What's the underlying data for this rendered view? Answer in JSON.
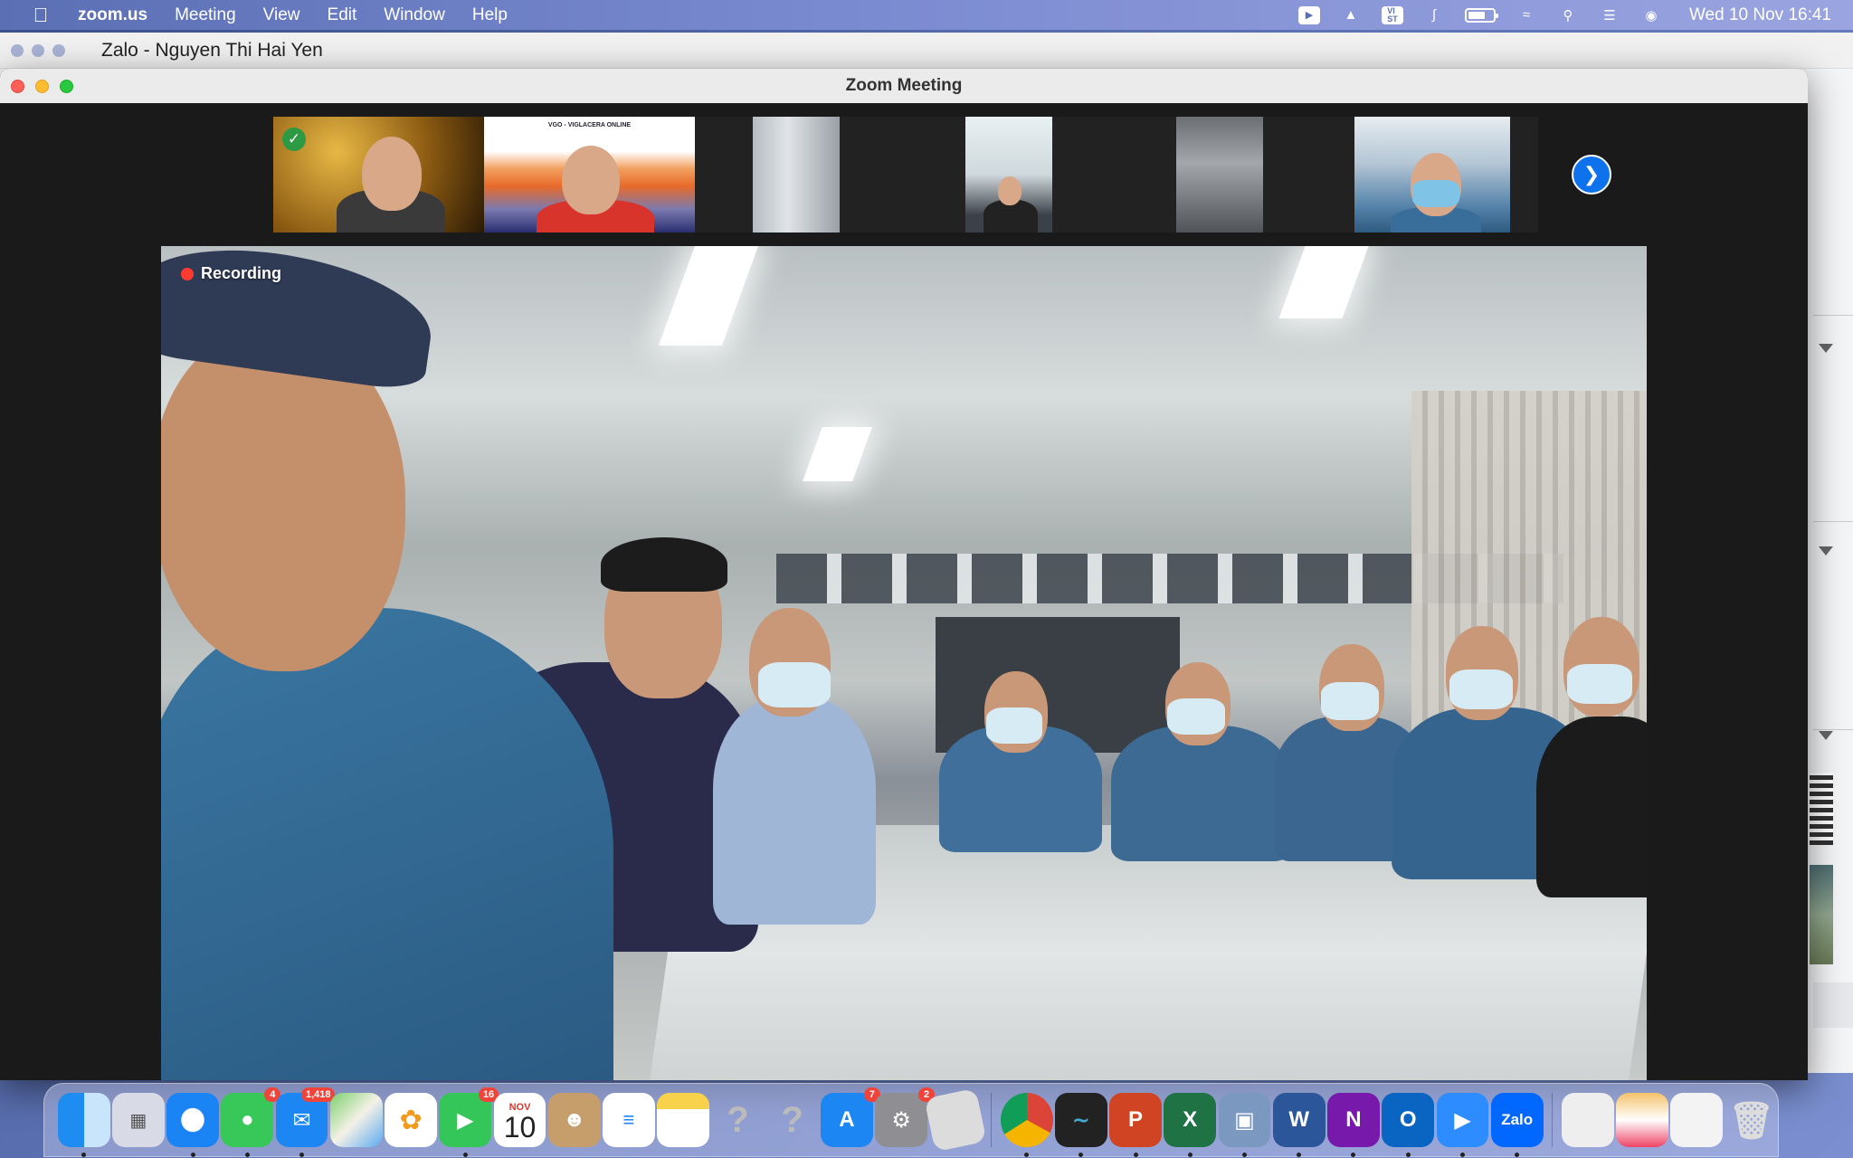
{
  "menubar": {
    "app_name": "zoom.us",
    "menus": [
      "Meeting",
      "View",
      "Edit",
      "Window",
      "Help"
    ],
    "status_icons": [
      "zoom-icon",
      "drive-icon",
      "vi-st-keyboard-icon",
      "bluetooth-icon",
      "battery-icon",
      "wifi-icon",
      "spotlight-search-icon",
      "control-center-icon",
      "siri-icon"
    ],
    "vi_label": "VI\nST",
    "clock": "Wed 10 Nov  16:41",
    "battery_level": 0.7
  },
  "zalo_window": {
    "title": "Zalo - Nguyen Thi Hai Yen"
  },
  "zoom_window": {
    "title": "Zoom Meeting",
    "recording_label": "Recording",
    "gallery_tile_sign": "VGO - VIGLACERA ONLINE",
    "next_page_icon": "chevron-right-icon",
    "accent": "#0e72ed"
  },
  "dock": {
    "apps": [
      {
        "name": "Finder",
        "badge": ""
      },
      {
        "name": "Launchpad",
        "badge": ""
      },
      {
        "name": "Safari",
        "badge": ""
      },
      {
        "name": "Messages",
        "badge": "4"
      },
      {
        "name": "Mail",
        "badge": "1,418"
      },
      {
        "name": "Maps",
        "badge": ""
      },
      {
        "name": "Photos",
        "badge": ""
      },
      {
        "name": "FaceTime",
        "badge": "16"
      },
      {
        "name": "Calendar",
        "badge": "",
        "month": "NOV",
        "day": "10"
      },
      {
        "name": "Contacts",
        "badge": ""
      },
      {
        "name": "Reminders",
        "badge": ""
      },
      {
        "name": "Notes",
        "badge": ""
      },
      {
        "name": "Unknown1",
        "badge": ""
      },
      {
        "name": "Unknown2",
        "badge": ""
      },
      {
        "name": "App Store",
        "badge": "7"
      },
      {
        "name": "System Preferences",
        "badge": "2"
      },
      {
        "name": "Roblox",
        "badge": ""
      },
      {
        "name": "Chrome",
        "badge": ""
      },
      {
        "name": "Stocks",
        "badge": ""
      },
      {
        "name": "PowerPoint",
        "badge": ""
      },
      {
        "name": "Excel",
        "badge": ""
      },
      {
        "name": "Preview",
        "badge": ""
      },
      {
        "name": "Word",
        "badge": ""
      },
      {
        "name": "OneNote",
        "badge": ""
      },
      {
        "name": "Outlook",
        "badge": ""
      },
      {
        "name": "Zoom",
        "badge": ""
      },
      {
        "name": "Zalo",
        "badge": "",
        "label": "Zalo"
      },
      {
        "name": "Documents",
        "badge": ""
      },
      {
        "name": "Downloads",
        "badge": ""
      },
      {
        "name": "Screenshots",
        "badge": ""
      },
      {
        "name": "Trash",
        "badge": ""
      }
    ]
  }
}
